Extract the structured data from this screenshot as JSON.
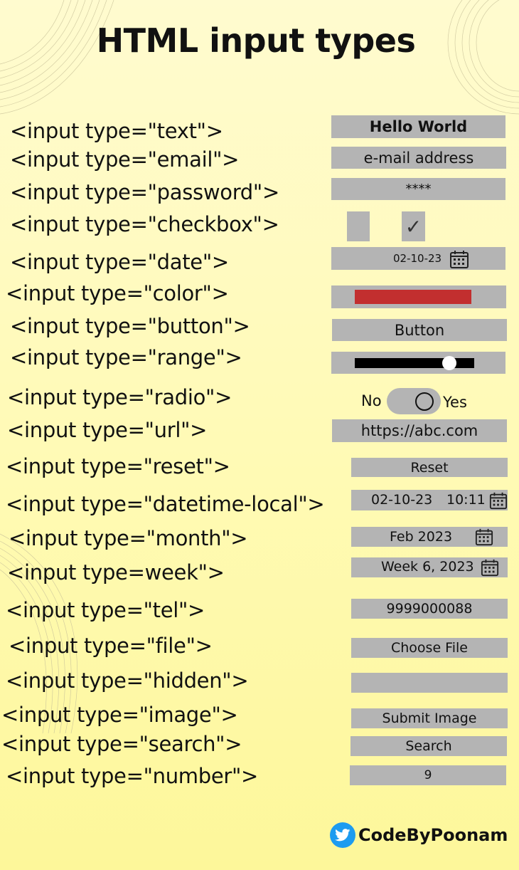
{
  "title": "HTML input types",
  "rows": [
    {
      "code": "<input type=\"text\">",
      "value": "Hello World"
    },
    {
      "code": "<input type=\"email\">",
      "value": "e-mail address"
    },
    {
      "code": "<input type=\"password\">",
      "value": "****"
    },
    {
      "code": "<input type=\"checkbox\">",
      "value": "✓"
    },
    {
      "code": "<input type=\"date\">",
      "value": "02-10-23"
    },
    {
      "code": "<input type=\"color\">",
      "color": "#c22f2f"
    },
    {
      "code": "<input type=\"button\">",
      "value": "Button"
    },
    {
      "code": "<input type=\"range\">",
      "range_fraction": 0.79
    },
    {
      "code": "<input type=\"radio\">",
      "no": "No",
      "yes": "Yes"
    },
    {
      "code": "<input type=\"url\">",
      "value": "https://abc.com"
    },
    {
      "code": "<input type=\"reset\">",
      "value": "Reset"
    },
    {
      "code": "<input type=\"datetime-local\">",
      "date": "02-10-23",
      "time": "10:11"
    },
    {
      "code": "<input type=\"month\">",
      "value": "Feb 2023"
    },
    {
      "code": "<input type=week\">",
      "value": "Week 6, 2023"
    },
    {
      "code": "<input type=\"tel\">",
      "value": "9999000088"
    },
    {
      "code": "<input type=\"file\">",
      "value": "Choose File"
    },
    {
      "code": "<input type=\"hidden\">",
      "value": ""
    },
    {
      "code": "<input type=\"image\">",
      "value": "Submit Image"
    },
    {
      "code": "<input type=\"search\">",
      "value": "Search"
    },
    {
      "code": "<input type=\"number\">",
      "value": "9"
    }
  ],
  "footer": {
    "handle": "CodeByPoonam",
    "icon": "twitter-bird-icon"
  },
  "colors": {
    "field": "#b4b4b4",
    "twitter": "#1d9bf0",
    "color_swatch": "#c22f2f"
  }
}
